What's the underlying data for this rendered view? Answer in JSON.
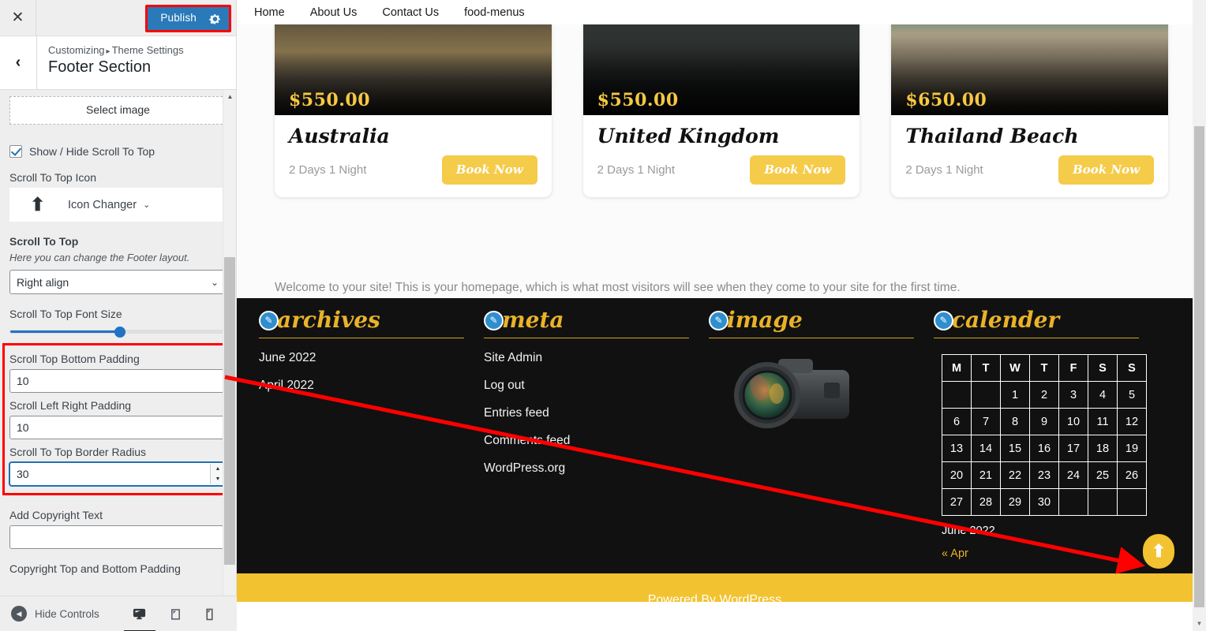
{
  "customizer": {
    "close_icon": "✕",
    "publish_label": "Publish",
    "gear_icon": "gear-icon",
    "back_icon": "‹",
    "breadcrumb_root": "Customizing",
    "breadcrumb_sep": "▸",
    "breadcrumb_current": "Theme Settings",
    "panel_title": "Footer Section",
    "select_image_label": "Select image",
    "show_hide_label": "Show / Hide Scroll To Top",
    "scroll_icon_label": "Scroll To Top Icon",
    "icon_changer_label": "Icon Changer",
    "icon_changer_glyph": "⬆",
    "icon_changer_caret": "⌄",
    "scroll_to_top_label": "Scroll To Top",
    "scroll_to_top_help": "Here you can change the Footer layout.",
    "align_value": "Right align",
    "align_options": [
      "Right align"
    ],
    "font_size_label": "Scroll To Top Font Size",
    "font_size_percent": 51,
    "highlighted": {
      "top_bottom_padding_label": "Scroll Top Bottom Padding",
      "top_bottom_padding_value": "10",
      "left_right_padding_label": "Scroll Left Right Padding",
      "left_right_padding_value": "10",
      "border_radius_label": "Scroll To Top Border Radius",
      "border_radius_value": "30"
    },
    "copyright_label": "Add Copyright Text",
    "copyright_value": "",
    "copyright_padding_label": "Copyright Top and Bottom Padding",
    "hide_controls_label": "Hide Controls",
    "devices": [
      "desktop-icon",
      "tablet-icon",
      "mobile-icon"
    ],
    "accent_blue": "#2a7ab9",
    "highlight_red": "#ff0000"
  },
  "preview": {
    "nav": [
      {
        "label": "Home"
      },
      {
        "label": "About Us"
      },
      {
        "label": "Contact Us"
      },
      {
        "label": "food-menus"
      }
    ],
    "cards": [
      {
        "price": "$550.00",
        "title": "Australia",
        "duration": "2 Days 1 Night",
        "button": "Book Now"
      },
      {
        "price": "$550.00",
        "title": "United Kingdom",
        "duration": "2 Days 1 Night",
        "button": "Book Now"
      },
      {
        "price": "$650.00",
        "title": "Thailand Beach",
        "duration": "2 Days 1 Night",
        "button": "Book Now"
      }
    ],
    "welcome_text": "Welcome to your site! This is your homepage, which is what most visitors will see when they come to your site for the first time.",
    "footer": {
      "widgets": [
        {
          "title": "archives",
          "edit_icon": "pencil-icon",
          "links": [
            "June 2022",
            "April 2022"
          ]
        },
        {
          "title": "meta",
          "edit_icon": "pencil-icon",
          "links": [
            "Site Admin",
            "Log out",
            "Entries feed",
            "Comments feed",
            "WordPress.org"
          ]
        },
        {
          "title": "image",
          "edit_icon": "pencil-icon",
          "image_alt": "camera-photo"
        },
        {
          "title": "calender",
          "edit_icon": "pencil-icon"
        }
      ],
      "calendar": {
        "headers": [
          "M",
          "T",
          "W",
          "T",
          "F",
          "S",
          "S"
        ],
        "weeks": [
          [
            "",
            "",
            "1",
            "2",
            "3",
            "4",
            "5"
          ],
          [
            "6",
            "7",
            "8",
            "9",
            "10",
            "11",
            "12"
          ],
          [
            "13",
            "14",
            "15",
            "16",
            "17",
            "18",
            "19"
          ],
          [
            "20",
            "21",
            "22",
            "23",
            "24",
            "25",
            "26"
          ],
          [
            "27",
            "28",
            "29",
            "30",
            "",
            "",
            ""
          ]
        ],
        "caption": "June 2022",
        "prev_link": "« Apr"
      },
      "scroll_top_icon": "⬆",
      "copyright_text": "Powered By WordPress"
    }
  }
}
